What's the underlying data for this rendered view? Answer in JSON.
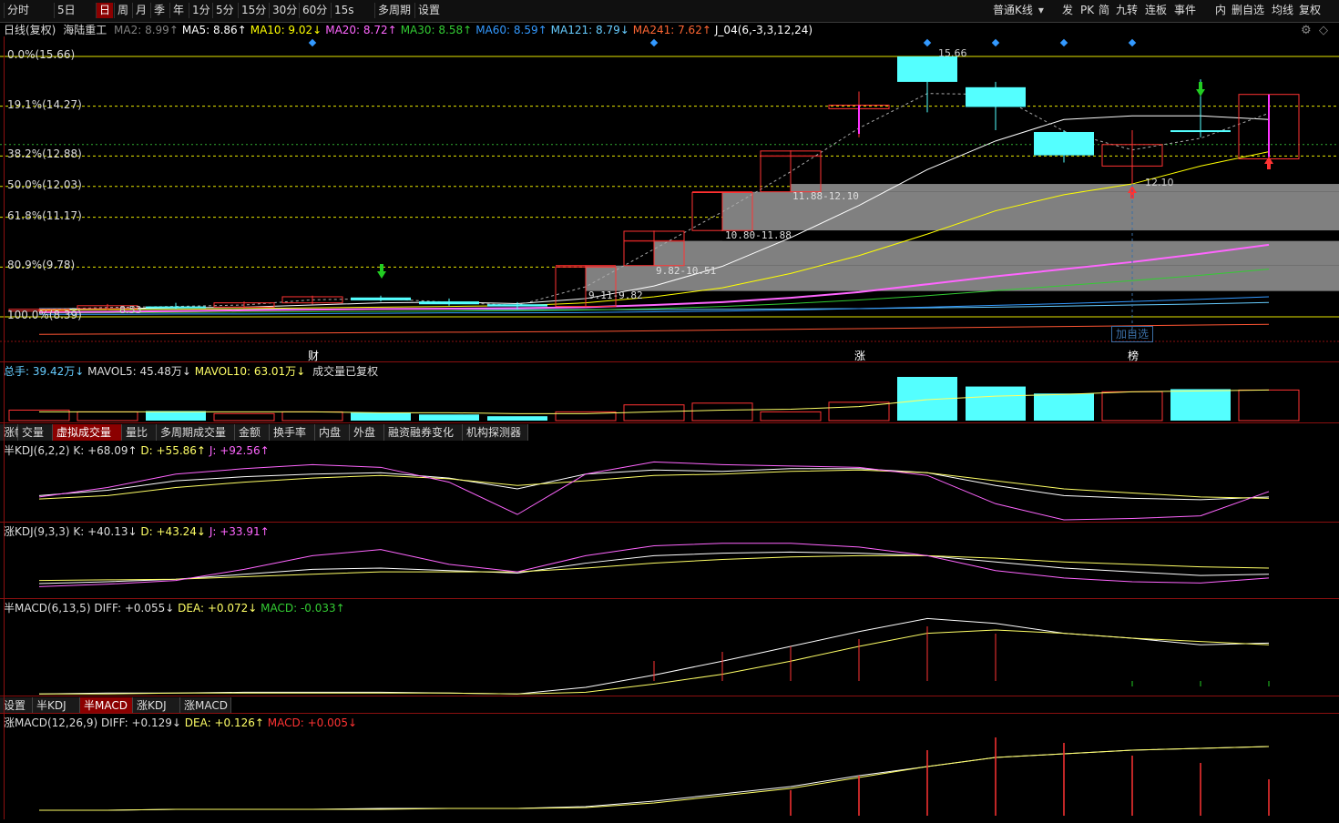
{
  "toolbar": {
    "items": [
      "分时",
      "5日",
      "日",
      "周",
      "月",
      "季",
      "年",
      "1分",
      "5分",
      "15分",
      "30分",
      "60分",
      "15s",
      "多周期",
      "设置"
    ],
    "active": "日",
    "kline_type": "普通K线",
    "right_items": [
      "发",
      "PK",
      "简",
      "九转",
      "连板",
      "事件",
      "内",
      "删自选",
      "均线",
      "复权"
    ]
  },
  "ma_line": {
    "title": "日线(复权)",
    "stock_name": "海陆重工",
    "items": [
      {
        "label": "MA2: 8.99",
        "arrow": "↑",
        "color": "#808080"
      },
      {
        "label": "MA5: 8.86",
        "arrow": "↑",
        "color": "#ffffff"
      },
      {
        "label": "MA10: 9.02",
        "arrow": "↓",
        "color": "#ffff00"
      },
      {
        "label": "MA20: 8.72",
        "arrow": "↑",
        "color": "#ff66ff"
      },
      {
        "label": "MA30: 8.58",
        "arrow": "↑",
        "color": "#33cc33"
      },
      {
        "label": "MA60: 8.59",
        "arrow": "↑",
        "color": "#3399ff"
      },
      {
        "label": "MA121: 8.79",
        "arrow": "↓",
        "color": "#66ccff"
      },
      {
        "label": "MA241: 7.62",
        "arrow": "↑",
        "color": "#ff6633"
      },
      {
        "label": "J_04(6,-3,3,12,24)",
        "arrow": "",
        "color": "#ffffff"
      }
    ]
  },
  "fib_levels": [
    {
      "label": "0.0%(15.66)",
      "price": 15.66
    },
    {
      "label": "19.1%(14.27)",
      "price": 14.27
    },
    {
      "label": "38.2%(12.88)",
      "price": 12.88
    },
    {
      "label": "50.0%(12.03)",
      "price": 12.03
    },
    {
      "label": "61.8%(11.17)",
      "price": 11.17
    },
    {
      "label": "80.9%(9.78)",
      "price": 9.78
    },
    {
      "label": "100.0%(8.39)",
      "price": 8.39
    }
  ],
  "price_annotations": {
    "high": "15.66",
    "low": "8.53",
    "mark": "12.10",
    "zones": [
      "11.88-12.10",
      "10.80-11.88",
      "9.82-10.51",
      "9.11-9.82"
    ]
  },
  "event_markers": [
    "财",
    "涨",
    "榜"
  ],
  "add_watch_label": "加自选",
  "volume_info": {
    "total": "总手: 39.42万",
    "total_arrow": "↓",
    "mavol5": "MAVOL5: 45.48万",
    "mavol5_arrow": "↓",
    "mavol10": "MAVOL10: 63.01万",
    "mavol10_arrow": "↓",
    "note": "成交量已复权"
  },
  "sub_tabs1": [
    "涨幅",
    "交量",
    "虚拟成交量",
    "量比",
    "多周期成交量",
    "金额",
    "换手率",
    "内盘",
    "外盘",
    "融资融券变化",
    "机构探测器"
  ],
  "sub_tabs1_active": "虚拟成交量",
  "kdj1": {
    "name": "半KDJ(6,2,2)",
    "k": "K: +68.09",
    "k_arrow": "↑",
    "d": "D: +55.86",
    "d_arrow": "↑",
    "j": "J: +92.56",
    "j_arrow": "↑"
  },
  "kdj2": {
    "name": "涨KDJ(9,3,3)",
    "k": "K: +40.13",
    "k_arrow": "↓",
    "d": "D: +43.24",
    "d_arrow": "↓",
    "j": "J: +33.91",
    "j_arrow": "↑"
  },
  "macd1": {
    "name": "半MACD(6,13,5)",
    "diff": "DIFF: +0.055",
    "diff_arrow": "↓",
    "dea": "DEA: +0.072",
    "dea_arrow": "↓",
    "macd": "MACD: -0.033",
    "macd_arrow": "↑"
  },
  "sub_tabs2": [
    "设置",
    "半KDJ",
    "半MACD",
    "涨KDJ",
    "涨MACD"
  ],
  "sub_tabs2_active": "半MACD",
  "macd2": {
    "name": "涨MACD(12,26,9)",
    "diff": "DIFF: +0.129",
    "diff_arrow": "↓",
    "dea": "DEA: +0.126",
    "dea_arrow": "↑",
    "macd": "MACD: +0.005",
    "macd_arrow": "↓"
  },
  "chart_data": {
    "type": "candlestick",
    "candles": [
      {
        "o": 8.55,
        "h": 8.62,
        "l": 8.53,
        "c": 8.6
      },
      {
        "o": 8.62,
        "h": 8.75,
        "l": 8.58,
        "c": 8.7
      },
      {
        "o": 8.68,
        "h": 8.78,
        "l": 8.6,
        "c": 8.66
      },
      {
        "o": 8.66,
        "h": 8.82,
        "l": 8.62,
        "c": 8.78
      },
      {
        "o": 8.78,
        "h": 8.98,
        "l": 8.74,
        "c": 8.95
      },
      {
        "o": 8.93,
        "h": 8.98,
        "l": 8.82,
        "c": 8.85
      },
      {
        "o": 8.82,
        "h": 8.9,
        "l": 8.7,
        "c": 8.74
      },
      {
        "o": 8.74,
        "h": 8.8,
        "l": 8.6,
        "c": 8.68
      },
      {
        "o": 8.68,
        "h": 9.82,
        "l": 8.66,
        "c": 9.78
      },
      {
        "o": 9.82,
        "h": 10.8,
        "l": 9.8,
        "c": 10.78
      },
      {
        "o": 10.8,
        "h": 11.88,
        "l": 10.78,
        "c": 11.86
      },
      {
        "o": 11.88,
        "h": 13.04,
        "l": 11.86,
        "c": 13.02
      },
      {
        "o": 14.2,
        "h": 14.68,
        "l": 13.4,
        "c": 14.3
      },
      {
        "o": 15.66,
        "h": 15.66,
        "l": 14.1,
        "c": 14.95
      },
      {
        "o": 14.8,
        "h": 14.95,
        "l": 13.6,
        "c": 14.25
      },
      {
        "o": 13.55,
        "h": 13.6,
        "l": 12.7,
        "c": 12.9
      },
      {
        "o": 12.6,
        "h": 13.6,
        "l": 12.1,
        "c": 13.2
      },
      {
        "o": 13.6,
        "h": 15.02,
        "l": 13.4,
        "c": 13.55
      },
      {
        "o": 12.8,
        "h": 14.6,
        "l": 12.8,
        "c": 14.6
      }
    ],
    "volume": [
      1.2,
      1.0,
      1.1,
      0.8,
      1.0,
      0.9,
      0.7,
      0.5,
      1.0,
      1.8,
      2.0,
      1.0,
      2.1,
      5.0,
      3.9,
      3.1,
      3.3,
      3.6,
      3.5
    ],
    "volume_up": [
      true,
      true,
      false,
      true,
      true,
      false,
      false,
      false,
      true,
      true,
      true,
      true,
      true,
      false,
      false,
      false,
      true,
      false,
      true
    ],
    "ylim": [
      8.2,
      16.5
    ]
  }
}
